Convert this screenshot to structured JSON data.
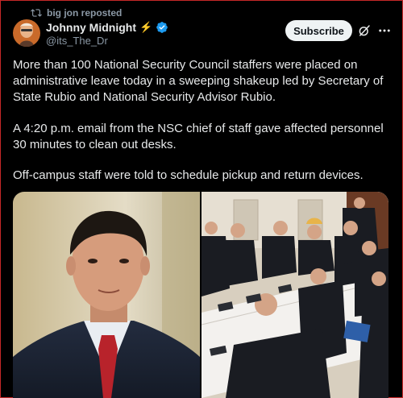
{
  "repost": {
    "text": "big jon reposted",
    "icon": "repost-icon"
  },
  "author": {
    "name": "Johnny Midnight",
    "name_emoji": "⚡",
    "handle": "@its_The_Dr",
    "verified_color": "#1d9bf0"
  },
  "actions": {
    "subscribe_label": "Subscribe"
  },
  "post": {
    "paragraphs": [
      "More than 100 National Security Council staffers were placed on administrative leave today in a sweeping shakeup led by Secretary of State Rubio and National Security Advisor Rubio.",
      "A 4:20 p.m. email from the NSC chief of staff gave affected personnel 30 minutes to clean out desks.",
      "Off-campus staff were told to schedule pickup and return devices."
    ]
  },
  "media": [
    {
      "icon": "portrait-photo"
    },
    {
      "icon": "meeting-room-photo"
    }
  ],
  "colors": {
    "background": "#000000",
    "text": "#e7e9ea",
    "secondary": "#8b98a5",
    "border": "#c62828"
  }
}
